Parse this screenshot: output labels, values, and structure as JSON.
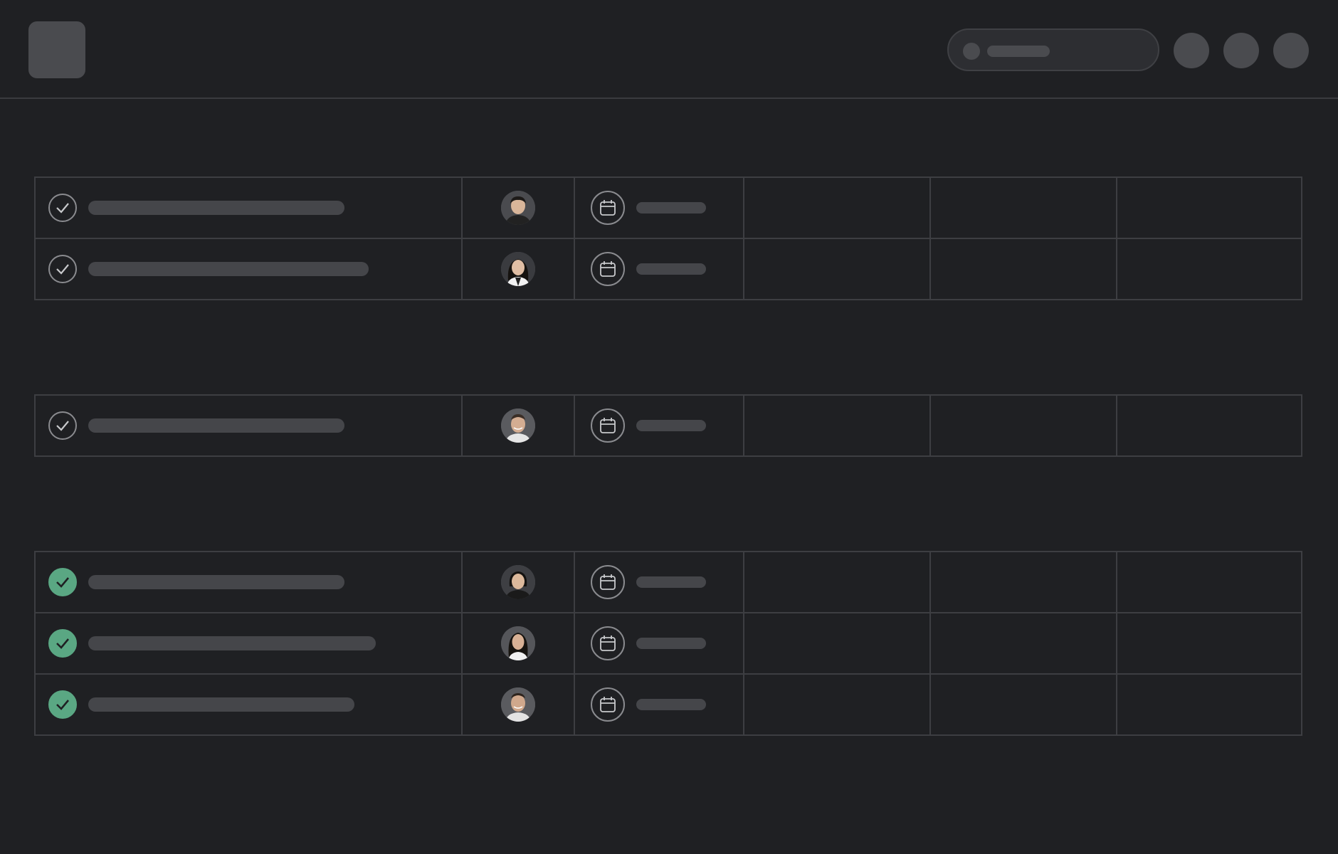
{
  "header": {
    "logo": "app-logo",
    "search": {
      "icon": "search-icon"
    },
    "actions": [
      "action-button-1",
      "action-button-2",
      "action-button-3"
    ]
  },
  "groups": [
    {
      "rows": [
        {
          "status": "incomplete",
          "avatar": "man-short-hair"
        },
        {
          "status": "incomplete",
          "avatar": "woman-long-hair"
        }
      ]
    },
    {
      "rows": [
        {
          "status": "incomplete",
          "avatar": "man-smiling"
        }
      ]
    },
    {
      "rows": [
        {
          "status": "complete",
          "avatar": "woman-short-hair"
        },
        {
          "status": "complete",
          "avatar": "woman-long-hair-2"
        },
        {
          "status": "complete",
          "avatar": "man-smiling-2"
        }
      ]
    }
  ],
  "colors": {
    "background": "#1f2023",
    "border": "#3d3e42",
    "placeholder": "#45464a",
    "complete": "#5aa783",
    "icon_stroke": "#8a8b8f"
  }
}
